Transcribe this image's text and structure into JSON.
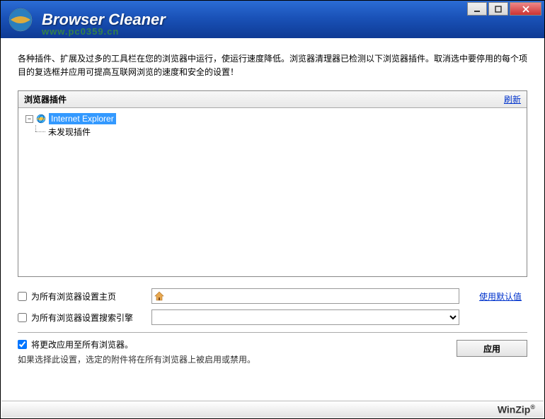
{
  "titlebar": {
    "title": "Browser Cleaner",
    "watermark": "www.pc0359.cn"
  },
  "description": "各种插件、扩展及过多的工具栏在您的浏览器中运行，使运行速度降低。浏览器清理器已检测以下浏览器插件。取消选中要停用的每个项目的复选框并应用可提高互联网浏览的速度和安全的设置！",
  "panel": {
    "title": "浏览器插件",
    "refresh": "刷新"
  },
  "tree": {
    "root_label": "Internet Explorer",
    "child_label": "未发现插件"
  },
  "settings": {
    "homepage_label": "为所有浏览器设置主页",
    "homepage_value": "",
    "use_default": "使用默认值",
    "search_label": "为所有浏览器设置搜索引擎",
    "search_value": ""
  },
  "bottom": {
    "apply_all_label": "将更改应用至所有浏览器。",
    "hint": "如果选择此设置，选定的附件将在所有浏览器上被启用或禁用。",
    "apply_button": "应用"
  },
  "footer": {
    "brand": "WinZip"
  }
}
